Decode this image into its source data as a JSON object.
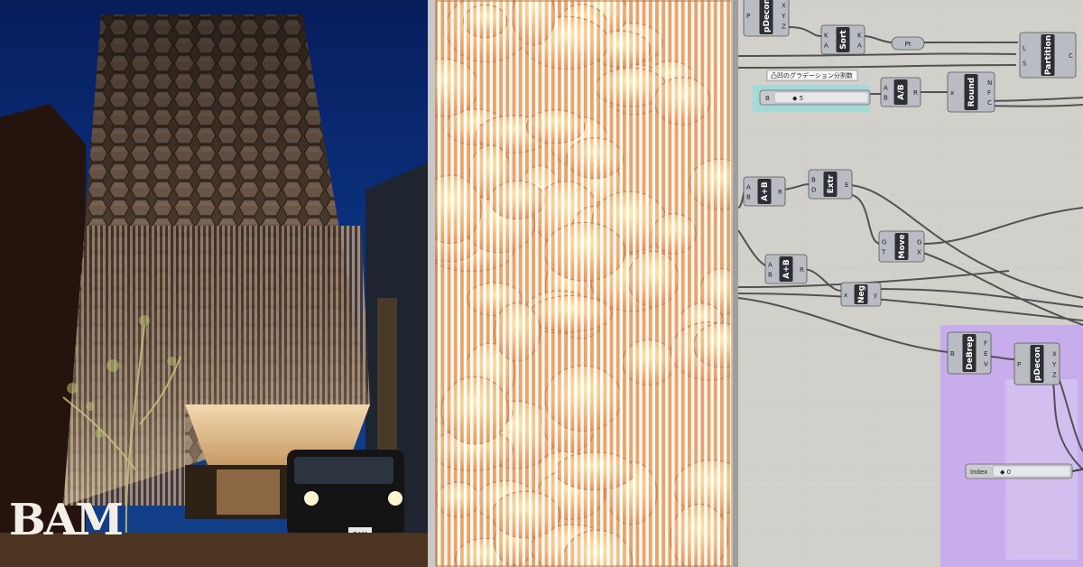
{
  "photo": {
    "sign_text": "BAM",
    "taxi_plate": "BAM"
  },
  "grasshopper": {
    "components": [
      {
        "id": "pdecon-top",
        "label": "pDecon",
        "inputs": [
          "P"
        ],
        "outputs": [
          "X",
          "Y",
          "Z"
        ]
      },
      {
        "id": "sort",
        "label": "Sort",
        "inputs": [
          "K",
          "A"
        ],
        "outputs": [
          "K",
          "A"
        ]
      },
      {
        "id": "pt",
        "label": "Pt"
      },
      {
        "id": "partition",
        "label": "Partition",
        "inputs": [
          "L",
          "S"
        ],
        "outputs": [
          "C"
        ]
      },
      {
        "id": "division",
        "label": "A/B",
        "inputs": [
          "A",
          "B"
        ],
        "outputs": [
          "R"
        ]
      },
      {
        "id": "round",
        "label": "Round",
        "inputs": [
          "x"
        ],
        "outputs": [
          "N",
          "F",
          "C"
        ]
      },
      {
        "id": "addition-1",
        "label": "A+B",
        "inputs": [
          "A",
          "B"
        ],
        "outputs": [
          "R"
        ]
      },
      {
        "id": "extr",
        "label": "Extr",
        "inputs": [
          "B",
          "D"
        ],
        "outputs": [
          "E"
        ]
      },
      {
        "id": "move",
        "label": "Move",
        "inputs": [
          "G",
          "T"
        ],
        "outputs": [
          "G",
          "X"
        ]
      },
      {
        "id": "addition-2",
        "label": "A+B",
        "inputs": [
          "A",
          "B"
        ],
        "outputs": [
          "R"
        ]
      },
      {
        "id": "neg",
        "label": "Neg",
        "inputs": [
          "x"
        ],
        "outputs": [
          "y"
        ]
      },
      {
        "id": "debrep",
        "label": "DeBrep",
        "inputs": [
          "B"
        ],
        "outputs": [
          "F",
          "E",
          "V"
        ]
      },
      {
        "id": "pdecon-bottom",
        "label": "pDecon",
        "inputs": [
          "P"
        ],
        "outputs": [
          "X",
          "Y",
          "Z"
        ]
      }
    ],
    "slider_gradient": {
      "tooltip": "凸凹のグラデーション分割数",
      "label": "B",
      "value": "◆ 5"
    },
    "slider_index": {
      "label": "Index",
      "value": "◆ 0"
    },
    "colors": {
      "canvas": "#d2d0cb",
      "component": "#b9bcc2",
      "group": "#c7a8f0",
      "selection": "#7ee0e6"
    }
  }
}
